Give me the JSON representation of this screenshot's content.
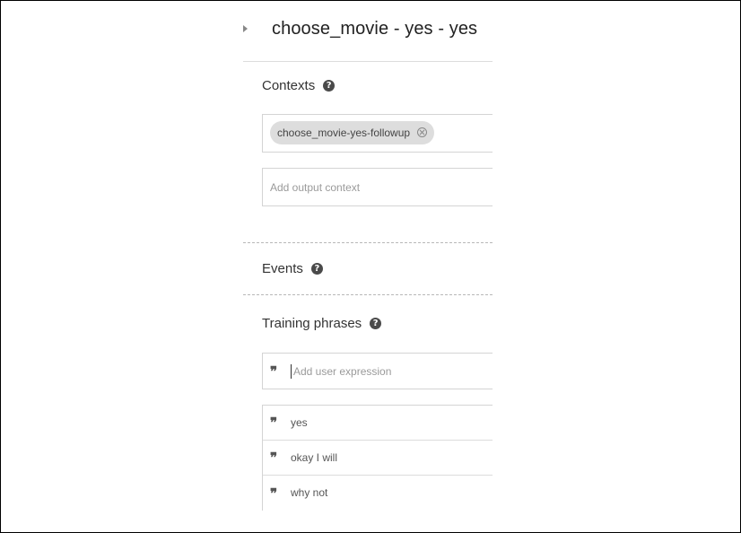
{
  "intent": {
    "title": "choose_movie - yes - yes"
  },
  "contexts": {
    "heading": "Contexts",
    "input_contexts": [
      {
        "label": "choose_movie-yes-followup"
      }
    ],
    "output_placeholder": "Add output context"
  },
  "events": {
    "heading": "Events"
  },
  "training": {
    "heading": "Training phrases",
    "input_placeholder": "Add user expression",
    "phrases": [
      "yes",
      "okay I will",
      "why not"
    ]
  },
  "icons": {
    "help": "help-icon",
    "quote": "quote-icon",
    "chip_remove": "close-circle-icon",
    "collapse": "caret-right-icon"
  },
  "colors": {
    "chip_bg": "#dddddd",
    "help_icon": "#4a4a4a",
    "frame_border": "#000000"
  }
}
